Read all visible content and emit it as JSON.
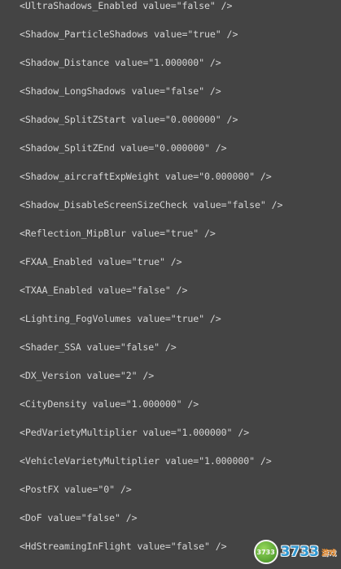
{
  "lines": [
    "<UltraShadows_Enabled value=\"false\" />",
    "<Shadow_ParticleShadows value=\"true\" />",
    "<Shadow_Distance value=\"1.000000\" />",
    "<Shadow_LongShadows value=\"false\" />",
    "<Shadow_SplitZStart value=\"0.000000\" />",
    "<Shadow_SplitZEnd value=\"0.000000\" />",
    "<Shadow_aircraftExpWeight value=\"0.000000\" />",
    "<Shadow_DisableScreenSizeCheck value=\"false\" />",
    "<Reflection_MipBlur value=\"true\" />",
    "<FXAA_Enabled value=\"true\" />",
    "<TXAA_Enabled value=\"false\" />",
    "<Lighting_FogVolumes value=\"true\" />",
    "<Shader_SSA value=\"false\" />",
    "<DX_Version value=\"2\" />",
    "<CityDensity value=\"1.000000\" />",
    "<PedVarietyMultiplier value=\"1.000000\" />",
    "<VehicleVarietyMultiplier value=\"1.000000\" />",
    "<PostFX value=\"0\" />",
    "<DoF value=\"false\" />",
    "<HdStreamingInFlight value=\"false\" />"
  ],
  "watermark": {
    "badge": "3733",
    "text": "3733",
    "suffix": "游戏"
  },
  "colors": {
    "background": "#444444",
    "text": "#d6d6d6"
  }
}
